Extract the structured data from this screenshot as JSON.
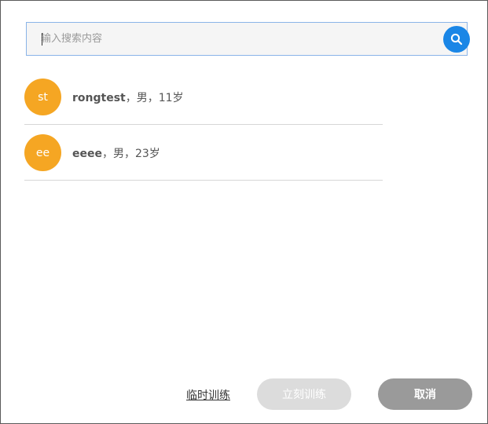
{
  "search": {
    "placeholder": "输入搜索内容",
    "value": ""
  },
  "icons": {
    "search_button": "search-icon"
  },
  "colors": {
    "accent_blue": "#1a86e6",
    "avatar_orange": "#f5a623",
    "disabled_button": "#dcdcdc",
    "cancel_button": "#9a9a9a"
  },
  "people": [
    {
      "initials": "st",
      "name": "rongtest",
      "details": "，男，11岁"
    },
    {
      "initials": "ee",
      "name": "eeee",
      "details": "，男，23岁"
    }
  ],
  "footer": {
    "temp_training_label": "临时训练",
    "start_now_label": "立刻训练",
    "cancel_label": "取消"
  }
}
